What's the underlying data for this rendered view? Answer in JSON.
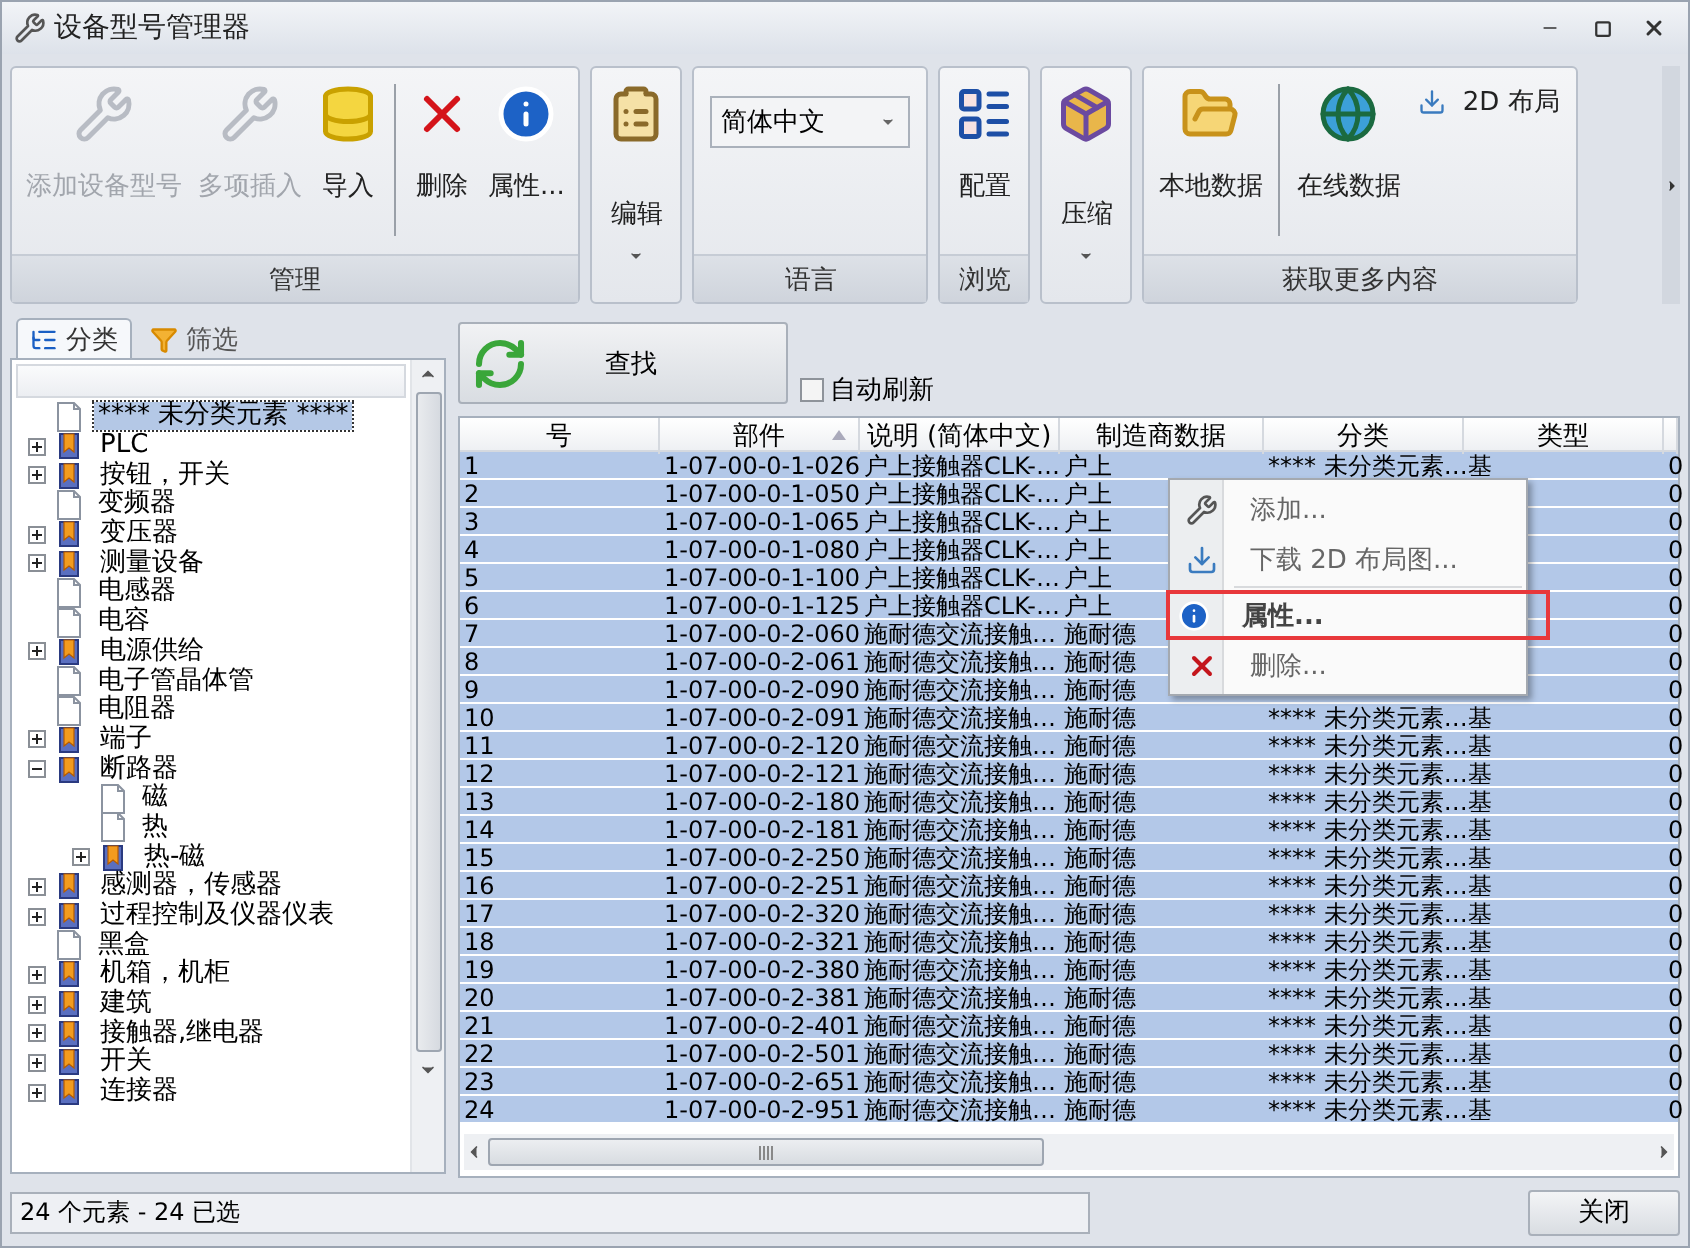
{
  "window": {
    "title": "设备型号管理器"
  },
  "ribbon": {
    "groups": [
      {
        "label": "管理",
        "buttons": [
          {
            "label": "添加设备型号",
            "kind": "large",
            "disabled": true,
            "separator_before": false
          },
          {
            "label": "多项插入",
            "kind": "large",
            "disabled": true,
            "separator_before": false
          },
          {
            "label": "导入",
            "kind": "large",
            "disabled": false,
            "separator_before": false
          },
          {
            "label": "删除",
            "kind": "large",
            "disabled": false,
            "separator_before": true
          },
          {
            "label": "属性...",
            "kind": "large",
            "disabled": false,
            "separator_before": false
          }
        ]
      },
      {
        "buttons": [
          {
            "label": "编辑",
            "kind": "dropdown",
            "disabled": false,
            "separator_before": false
          }
        ]
      },
      {
        "label": "语言",
        "combo": {
          "value": "简体中文"
        }
      },
      {
        "label": "浏览",
        "buttons": [
          {
            "label": "配置",
            "kind": "large",
            "disabled": false,
            "separator_before": false
          }
        ]
      },
      {
        "buttons": [
          {
            "label": "压缩",
            "kind": "dropdown",
            "disabled": false,
            "separator_before": false
          }
        ]
      },
      {
        "label": "获取更多内容",
        "buttons": [
          {
            "label": "本地数据",
            "kind": "large",
            "disabled": false,
            "separator_before": false
          },
          {
            "label": "在线数据",
            "kind": "large",
            "disabled": false,
            "separator_before": true
          },
          {
            "label": "2D 布局",
            "kind": "small",
            "disabled": false,
            "separator_before": false
          }
        ]
      }
    ]
  },
  "side_tabs": [
    {
      "label": "分类",
      "selected": true
    },
    {
      "label": "筛选",
      "selected": false
    }
  ],
  "tree": [
    {
      "label": "**** 未分类元素 ****",
      "kind": "item",
      "selected": true
    },
    {
      "label": "PLC",
      "kind": "category",
      "expanded": false,
      "selected": false
    },
    {
      "label": "按钮，开关",
      "kind": "category",
      "expanded": false,
      "selected": false
    },
    {
      "label": "变频器",
      "kind": "item",
      "selected": false
    },
    {
      "label": "变压器",
      "kind": "category",
      "expanded": false,
      "selected": false
    },
    {
      "label": "测量设备",
      "kind": "category",
      "expanded": false,
      "selected": false
    },
    {
      "label": "电感器",
      "kind": "item",
      "selected": false
    },
    {
      "label": "电容",
      "kind": "item",
      "selected": false
    },
    {
      "label": "电源供给",
      "kind": "category",
      "expanded": false,
      "selected": false
    },
    {
      "label": "电子管晶体管",
      "kind": "item",
      "selected": false
    },
    {
      "label": "电阻器",
      "kind": "item",
      "selected": false
    },
    {
      "label": "端子",
      "kind": "category",
      "expanded": false,
      "selected": false
    },
    {
      "label": "断路器",
      "kind": "category",
      "expanded": true,
      "selected": false,
      "children": [
        {
          "label": "磁",
          "kind": "item",
          "selected": false
        },
        {
          "label": "热",
          "kind": "item",
          "selected": false
        },
        {
          "label": "热-磁",
          "kind": "category",
          "expanded": false,
          "selected": false
        }
      ]
    },
    {
      "label": "感测器，传感器",
      "kind": "category",
      "expanded": false,
      "selected": false
    },
    {
      "label": "过程控制及仪器仪表",
      "kind": "category",
      "expanded": false,
      "selected": false
    },
    {
      "label": "黑盒",
      "kind": "item",
      "selected": false
    },
    {
      "label": "机箱，机柜",
      "kind": "category",
      "expanded": false,
      "selected": false
    },
    {
      "label": "建筑",
      "kind": "category",
      "expanded": false,
      "selected": false
    },
    {
      "label": "接触器,继电器",
      "kind": "category",
      "expanded": false,
      "selected": false
    },
    {
      "label": "开关",
      "kind": "category",
      "expanded": false,
      "selected": false
    },
    {
      "label": "连接器",
      "kind": "category",
      "expanded": false,
      "selected": false
    }
  ],
  "search_button": {
    "label": "查找"
  },
  "auto_refresh": {
    "label": "自动刷新",
    "checked": false
  },
  "table": {
    "columns": [
      {
        "label": "号",
        "sorted": false
      },
      {
        "label": "部件",
        "sorted": true
      },
      {
        "label": "说明 (简体中文)",
        "sorted": false
      },
      {
        "label": "制造商数据",
        "sorted": false
      },
      {
        "label": "分类",
        "sorted": false
      },
      {
        "label": "类型",
        "sorted": false
      }
    ],
    "rows": [
      {
        "number": "1",
        "part": "1-07-00-0-1-026",
        "description": "户上接触器CLK-…",
        "manufacturer": "户上",
        "category": "**** 未分类元素…",
        "type": "基",
        "column_7": "0",
        "selected": true
      },
      {
        "number": "2",
        "part": "1-07-00-0-1-050",
        "description": "户上接触器CLK-…",
        "manufacturer": "户上",
        "column_7": "0",
        "selected": true
      },
      {
        "number": "3",
        "part": "1-07-00-0-1-065",
        "description": "户上接触器CLK-…",
        "manufacturer": "户上",
        "column_7": "0",
        "selected": true
      },
      {
        "number": "4",
        "part": "1-07-00-0-1-080",
        "description": "户上接触器CLK-…",
        "manufacturer": "户上",
        "column_7": "0",
        "selected": true
      },
      {
        "number": "5",
        "part": "1-07-00-0-1-100",
        "description": "户上接触器CLK-…",
        "manufacturer": "户上",
        "column_7": "0",
        "selected": true
      },
      {
        "number": "6",
        "part": "1-07-00-0-1-125",
        "description": "户上接触器CLK-…",
        "manufacturer": "户上",
        "column_7": "0",
        "selected": true
      },
      {
        "number": "7",
        "part": "1-07-00-0-2-060",
        "description": "施耐德交流接触…",
        "manufacturer": "施耐德",
        "column_7": "0",
        "selected": true
      },
      {
        "number": "8",
        "part": "1-07-00-0-2-061",
        "description": "施耐德交流接触…",
        "manufacturer": "施耐德",
        "column_7": "0",
        "selected": true
      },
      {
        "number": "9",
        "part": "1-07-00-0-2-090",
        "description": "施耐德交流接触…",
        "manufacturer": "施耐德",
        "column_7": "0",
        "selected": true
      },
      {
        "number": "10",
        "part": "1-07-00-0-2-091",
        "description": "施耐德交流接触…",
        "manufacturer": "施耐德",
        "category": "**** 未分类元素…",
        "type": "基",
        "column_7": "0",
        "selected": true
      },
      {
        "number": "11",
        "part": "1-07-00-0-2-120",
        "description": "施耐德交流接触…",
        "manufacturer": "施耐德",
        "category": "**** 未分类元素…",
        "type": "基",
        "column_7": "0",
        "selected": true
      },
      {
        "number": "12",
        "part": "1-07-00-0-2-121",
        "description": "施耐德交流接触…",
        "manufacturer": "施耐德",
        "category": "**** 未分类元素…",
        "type": "基",
        "column_7": "0",
        "selected": true
      },
      {
        "number": "13",
        "part": "1-07-00-0-2-180",
        "description": "施耐德交流接触…",
        "manufacturer": "施耐德",
        "category": "**** 未分类元素…",
        "type": "基",
        "column_7": "0",
        "selected": true
      },
      {
        "number": "14",
        "part": "1-07-00-0-2-181",
        "description": "施耐德交流接触…",
        "manufacturer": "施耐德",
        "category": "**** 未分类元素…",
        "type": "基",
        "column_7": "0",
        "selected": true
      },
      {
        "number": "15",
        "part": "1-07-00-0-2-250",
        "description": "施耐德交流接触…",
        "manufacturer": "施耐德",
        "category": "**** 未分类元素…",
        "type": "基",
        "column_7": "0",
        "selected": true
      },
      {
        "number": "16",
        "part": "1-07-00-0-2-251",
        "description": "施耐德交流接触…",
        "manufacturer": "施耐德",
        "category": "**** 未分类元素…",
        "type": "基",
        "column_7": "0",
        "selected": true
      },
      {
        "number": "17",
        "part": "1-07-00-0-2-320",
        "description": "施耐德交流接触…",
        "manufacturer": "施耐德",
        "category": "**** 未分类元素…",
        "type": "基",
        "column_7": "0",
        "selected": true
      },
      {
        "number": "18",
        "part": "1-07-00-0-2-321",
        "description": "施耐德交流接触…",
        "manufacturer": "施耐德",
        "category": "**** 未分类元素…",
        "type": "基",
        "column_7": "0",
        "selected": true
      },
      {
        "number": "19",
        "part": "1-07-00-0-2-380",
        "description": "施耐德交流接触…",
        "manufacturer": "施耐德",
        "category": "**** 未分类元素…",
        "type": "基",
        "column_7": "0",
        "selected": true
      },
      {
        "number": "20",
        "part": "1-07-00-0-2-381",
        "description": "施耐德交流接触…",
        "manufacturer": "施耐德",
        "category": "**** 未分类元素…",
        "type": "基",
        "column_7": "0",
        "selected": true
      },
      {
        "number": "21",
        "part": "1-07-00-0-2-401",
        "description": "施耐德交流接触…",
        "manufacturer": "施耐德",
        "category": "**** 未分类元素…",
        "type": "基",
        "column_7": "0",
        "selected": true
      },
      {
        "number": "22",
        "part": "1-07-00-0-2-501",
        "description": "施耐德交流接触…",
        "manufacturer": "施耐德",
        "category": "**** 未分类元素…",
        "type": "基",
        "column_7": "0",
        "selected": true
      },
      {
        "number": "23",
        "part": "1-07-00-0-2-651",
        "description": "施耐德交流接触…",
        "manufacturer": "施耐德",
        "category": "**** 未分类元素…",
        "type": "基",
        "column_7": "0",
        "selected": true
      },
      {
        "number": "24",
        "part": "1-07-00-0-2-951",
        "description": "施耐德交流接触…",
        "manufacturer": "施耐德",
        "category": "**** 未分类元素…",
        "type": "基",
        "column_7": "0",
        "selected": true
      }
    ]
  },
  "context_menu": {
    "items": [
      {
        "label": "添加...",
        "highlighted": false,
        "separator_before": false
      },
      {
        "label": "下载 2D 布局图...",
        "highlighted": false,
        "separator_before": false
      },
      {
        "label": "属性...",
        "highlighted": true,
        "separator_before": true
      },
      {
        "label": "删除...",
        "highlighted": false,
        "separator_before": false
      }
    ]
  },
  "status_bar": {
    "text": "24 个元素 - 24 已选"
  },
  "close_button": {
    "label": "关闭"
  }
}
